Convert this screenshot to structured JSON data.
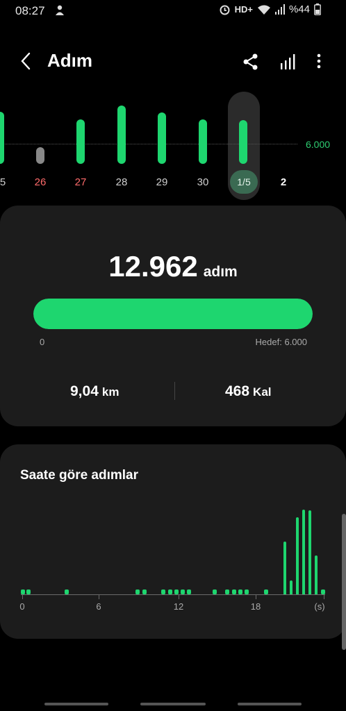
{
  "status_bar": {
    "time": "08:27",
    "network": "HD+",
    "battery": "%44"
  },
  "app_bar": {
    "title": "Adım"
  },
  "daily": {
    "goal_label": "6.000",
    "days": [
      {
        "label": "5",
        "weekend": false
      },
      {
        "label": "26",
        "weekend": true
      },
      {
        "label": "27",
        "weekend": true
      },
      {
        "label": "28",
        "weekend": false
      },
      {
        "label": "29",
        "weekend": false
      },
      {
        "label": "30",
        "weekend": false
      },
      {
        "label": "1/5",
        "weekend": false,
        "selected": true
      },
      {
        "label": "2",
        "weekend": false,
        "today": true
      }
    ]
  },
  "summary": {
    "steps": "12.962",
    "steps_unit": "adım",
    "progress_fraction": 1.0,
    "min_label": "0",
    "goal_label": "Hedef: 6.000",
    "distance_value": "9,04",
    "distance_unit": "km",
    "calories_value": "468",
    "calories_unit": "Kal"
  },
  "hourly": {
    "title": "Saate göre adımlar",
    "axis_labels": [
      "0",
      "6",
      "12",
      "18",
      "(s)"
    ]
  },
  "colors": {
    "accent": "#1ed66f",
    "card": "#1c1c1c",
    "weekend": "#ff6b6b"
  }
}
